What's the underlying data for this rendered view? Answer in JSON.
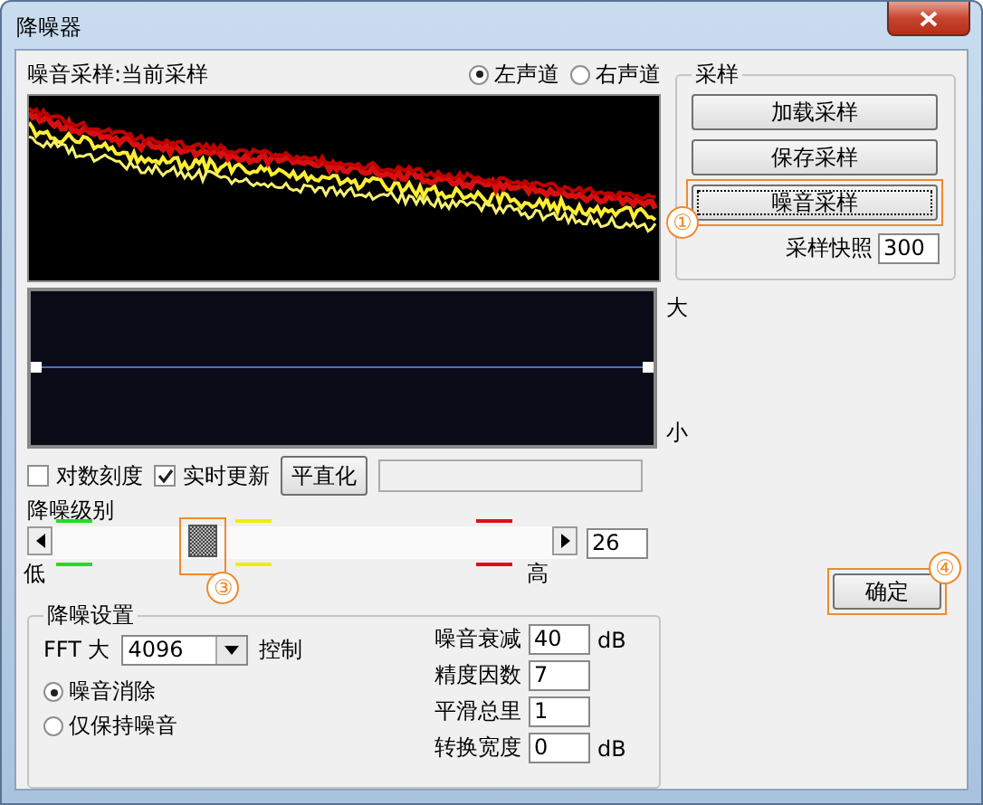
{
  "window": {
    "title": "降噪器"
  },
  "sample_label": "噪音采样:当前采样",
  "channels": [
    {
      "label": "左声道",
      "selected": true
    },
    {
      "label": "右声道",
      "selected": false
    }
  ],
  "scale_labels": {
    "top": "大",
    "bottom": "小"
  },
  "options": [
    {
      "label": "对数刻度",
      "checked": false
    },
    {
      "label": "实时更新",
      "checked": true
    }
  ],
  "flatten_button": "平直化",
  "reduction_level": {
    "label": "降噪级别",
    "low": "低",
    "high": "高",
    "level": 0.29,
    "value": "26",
    "callout": "③",
    "markers": [
      {
        "color": "#22dd22"
      },
      {
        "color": "#eeee00"
      },
      {
        "color": "#dd1111"
      }
    ]
  },
  "sampling": {
    "title": "采样",
    "buttons": [
      {
        "label": "加载采样",
        "focused": false
      },
      {
        "label": "保存采样",
        "focused": false
      },
      {
        "label": "噪音采样",
        "focused": true,
        "callout": "①"
      }
    ],
    "snapshot": {
      "label": "采样快照",
      "value": "300"
    }
  },
  "settings": {
    "title": "降噪设置",
    "fft": {
      "label": "FFT 大",
      "value": "4096",
      "suffix": "控制"
    },
    "modes": [
      {
        "label": "噪音消除",
        "selected": true
      },
      {
        "label": "仅保持噪音",
        "selected": false
      }
    ],
    "params": [
      {
        "label": "噪音衰减",
        "value": "40",
        "unit": "dB"
      },
      {
        "label": "精度因数",
        "value": "7"
      },
      {
        "label": "平滑总里",
        "value": "1"
      },
      {
        "label": "转换宽度",
        "value": "0",
        "unit": "dB"
      }
    ]
  },
  "ok_button": {
    "label": "确定",
    "callout": "④"
  }
}
